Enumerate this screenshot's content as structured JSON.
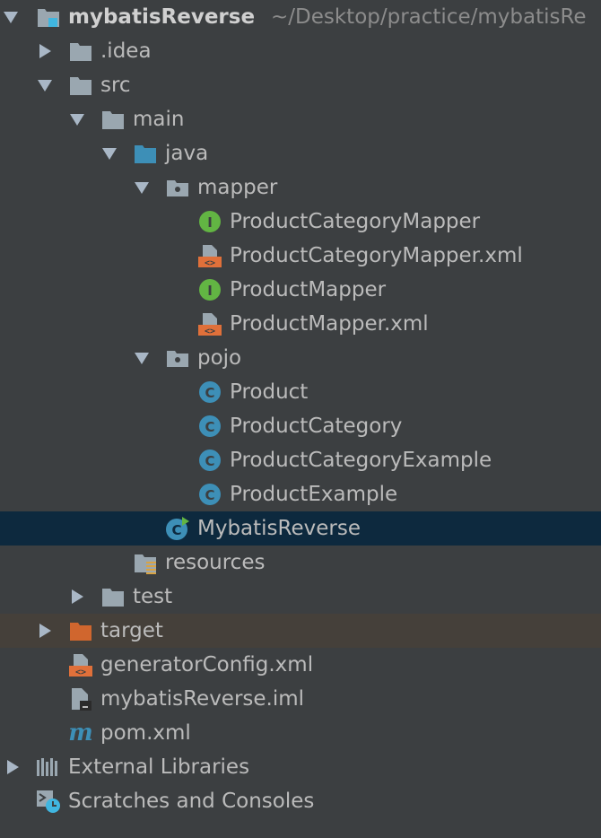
{
  "project": {
    "name": "mybatisReverse",
    "path": "~/Desktop/practice/mybatisRe"
  },
  "tree": {
    "idea": ".idea",
    "src": "src",
    "main": "main",
    "java": "java",
    "mapper": "mapper",
    "product_category_mapper": "ProductCategoryMapper",
    "product_category_mapper_xml": "ProductCategoryMapper.xml",
    "product_mapper": "ProductMapper",
    "product_mapper_xml": "ProductMapper.xml",
    "pojo": "pojo",
    "product": "Product",
    "product_category": "ProductCategory",
    "product_category_example": "ProductCategoryExample",
    "product_example": "ProductExample",
    "mybatis_reverse": "MybatisReverse",
    "resources": "resources",
    "test": "test",
    "target": "target",
    "generator_config": "generatorConfig.xml",
    "iml": "mybatisReverse.iml",
    "pom": "pom.xml",
    "external_libraries": "External Libraries",
    "scratches": "Scratches and Consoles"
  },
  "icons": {
    "interface_letter": "I",
    "class_letter": "C",
    "maven_letter": "m",
    "xml_glyph": "<>"
  },
  "colors": {
    "background": "#3c3f41",
    "selected_row": "#0d293e",
    "excluded_row": "#45403a",
    "folder_gray": "#9aa7b0",
    "source_folder_blue": "#40b6e0",
    "excluded_folder_orange": "#e07b39",
    "interface_green": "#62b543",
    "class_blue": "#40b6e0",
    "xml_orange": "#e0703a"
  }
}
